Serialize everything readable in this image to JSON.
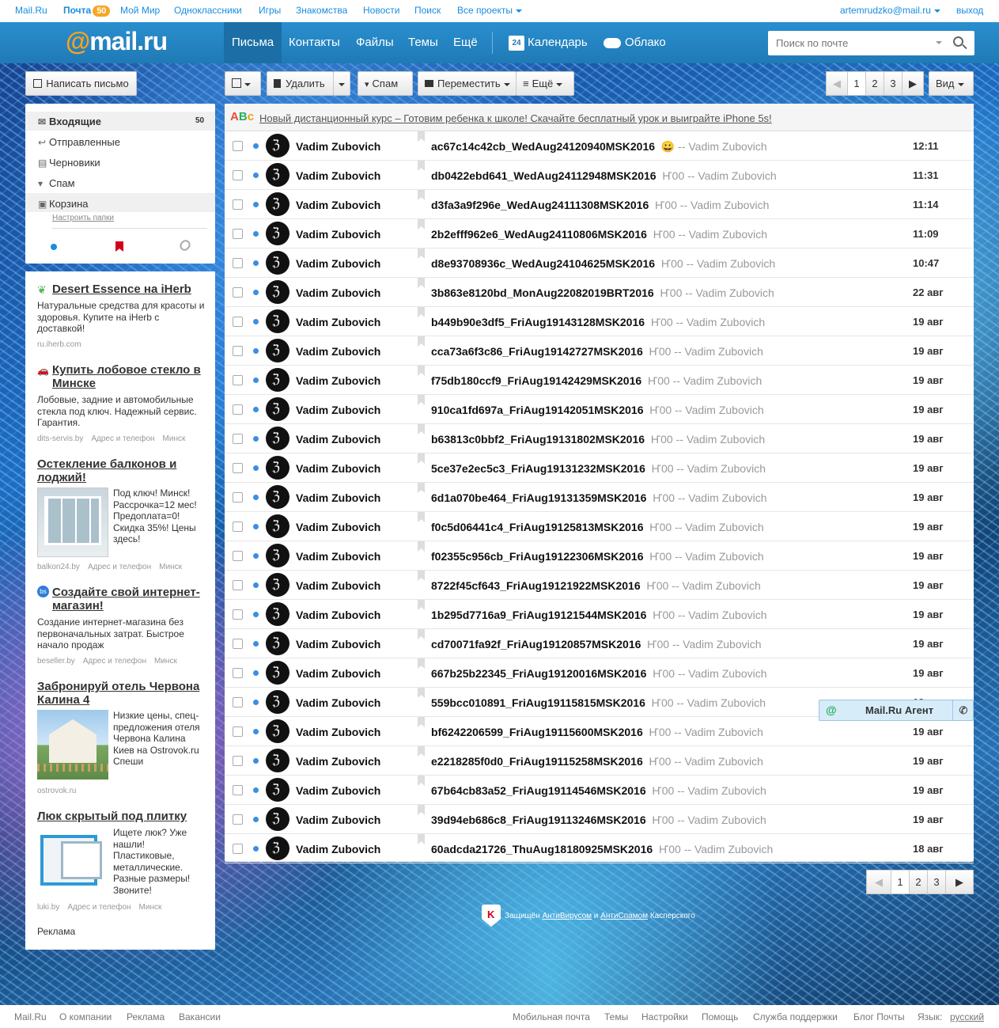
{
  "portal": {
    "links": [
      "Mail.Ru",
      "Почта",
      "Мой Мир",
      "Одноклассники",
      "Игры",
      "Знакомства",
      "Новости",
      "Поиск",
      "Все проекты"
    ],
    "mail_badge": "50",
    "user": "artemrudzko@mail.ru",
    "logout": "выход"
  },
  "header": {
    "logo_at": "@",
    "logo_text": "mail",
    "logo_tld": ".ru",
    "nav": [
      "Письма",
      "Контакты",
      "Файлы",
      "Темы",
      "Ещё"
    ],
    "calendar_day": "24",
    "calendar": "Календарь",
    "cloud": "Облако",
    "search_placeholder": "Поиск по почте"
  },
  "toolbar": {
    "compose": "Написать письмо",
    "delete": "Удалить",
    "spam": "Спам",
    "move": "Переместить",
    "more": "Ещё",
    "pages": [
      "1",
      "2",
      "3"
    ],
    "view": "Вид"
  },
  "folders": {
    "items": [
      {
        "label": "Входящие",
        "count": "50",
        "icon": "envelope-icon"
      },
      {
        "label": "Отправленные",
        "icon": "reply-icon"
      },
      {
        "label": "Черновики",
        "icon": "draft-icon"
      },
      {
        "label": "Спам",
        "icon": "thumb-down-icon"
      },
      {
        "label": "Корзина",
        "icon": "trash-icon"
      }
    ],
    "configure": "Настроить папки"
  },
  "ads": [
    {
      "title": "Desert Essence на iHerb",
      "text": "Натуральные средства для красоты и здоровья. Купите на iHerb с доставкой!",
      "source": "ru.iherb.com"
    },
    {
      "title": "Купить лобовое стекло в Минске",
      "text": "Лобовые, задние и автомобильные стекла под ключ. Надежный сервис. Гарантия.",
      "source": "dits-servis.by",
      "extra": [
        "Адрес и телефон",
        "Минск"
      ]
    },
    {
      "title": "Остекление балконов и лоджий!",
      "text": "Под ключ! Минск! Рассрочка=12 мес! Предоплата=0! Скидка 35%! Цены здесь!",
      "source": "balkon24.by",
      "extra": [
        "Адрес и телефон",
        "Минск"
      ]
    },
    {
      "title": "Создайте свой интернет-магазин!",
      "text": "Создание интернет-магазина без первоначальных затрат. Быстрое начало продаж",
      "source": "beseller.by",
      "extra": [
        "Адрес и телефон",
        "Минск"
      ]
    },
    {
      "title": "Забронируй отель Червона Калина 4",
      "text": "Низкие цены, спец-предложения отеля Червона Калина Киев на Ostrovok.ru Спеши",
      "source": "ostrovok.ru"
    },
    {
      "title": "Люк скрытый под плитку",
      "text": "Ищете люк? Уже нашли! Пластиковые, металлические. Разные размеры! Звоните!",
      "source": "luki.by",
      "extra": [
        "Адрес и телефон",
        "Минск"
      ]
    }
  ],
  "ads_label": "Реклама",
  "promo": "Новый дистанционный курс – Готовим ребенка к школе! Скачайте бесплатный урок и выиграйте iPhone 5s!",
  "messages": [
    {
      "from": "Vadim Zubovich",
      "subject": "ac67c14c42cb_WedAug24120940MSK2016",
      "snippet": "😀 -- Vadim Zubovich",
      "time": "12:11"
    },
    {
      "from": "Vadim Zubovich",
      "subject": "db0422ebd641_WedAug24112948MSK2016",
      "snippet": "Ҥ00 -- Vadim Zubovich",
      "time": "11:31"
    },
    {
      "from": "Vadim Zubovich",
      "subject": "d3fa3a9f296e_WedAug24111308MSK2016",
      "snippet": "Ҥ00 -- Vadim Zubovich",
      "time": "11:14"
    },
    {
      "from": "Vadim Zubovich",
      "subject": "2b2efff962e6_WedAug24110806MSK2016",
      "snippet": "Ҥ00 -- Vadim Zubovich",
      "time": "11:09"
    },
    {
      "from": "Vadim Zubovich",
      "subject": "d8e93708936c_WedAug24104625MSK2016",
      "snippet": "Ҥ00 -- Vadim Zubovich",
      "time": "10:47"
    },
    {
      "from": "Vadim Zubovich",
      "subject": "3b863e8120bd_MonAug22082019BRT2016",
      "snippet": "Ҥ00 -- Vadim Zubovich",
      "time": "22 авг"
    },
    {
      "from": "Vadim Zubovich",
      "subject": "b449b90e3df5_FriAug19143128MSK2016",
      "snippet": "Ҥ00 -- Vadim Zubovich",
      "time": "19 авг"
    },
    {
      "from": "Vadim Zubovich",
      "subject": "cca73a6f3c86_FriAug19142727MSK2016",
      "snippet": "Ҥ00 -- Vadim Zubovich",
      "time": "19 авг"
    },
    {
      "from": "Vadim Zubovich",
      "subject": "f75db180ccf9_FriAug19142429MSK2016",
      "snippet": "Ҥ00 -- Vadim Zubovich",
      "time": "19 авг"
    },
    {
      "from": "Vadim Zubovich",
      "subject": "910ca1fd697a_FriAug19142051MSK2016",
      "snippet": "Ҥ00 -- Vadim Zubovich",
      "time": "19 авг"
    },
    {
      "from": "Vadim Zubovich",
      "subject": "b63813c0bbf2_FriAug19131802MSK2016",
      "snippet": "Ҥ00 -- Vadim Zubovich",
      "time": "19 авг"
    },
    {
      "from": "Vadim Zubovich",
      "subject": "5ce37e2ec5c3_FriAug19131232MSK2016",
      "snippet": "Ҥ00 -- Vadim Zubovich",
      "time": "19 авг"
    },
    {
      "from": "Vadim Zubovich",
      "subject": "6d1a070be464_FriAug19131359MSK2016",
      "snippet": "Ҥ00 -- Vadim Zubovich",
      "time": "19 авг"
    },
    {
      "from": "Vadim Zubovich",
      "subject": "f0c5d06441c4_FriAug19125813MSK2016",
      "snippet": "Ҥ00 -- Vadim Zubovich",
      "time": "19 авг"
    },
    {
      "from": "Vadim Zubovich",
      "subject": "f02355c956cb_FriAug19122306MSK2016",
      "snippet": "Ҥ00 -- Vadim Zubovich",
      "time": "19 авг"
    },
    {
      "from": "Vadim Zubovich",
      "subject": "8722f45cf643_FriAug19121922MSK2016",
      "snippet": "Ҥ00 -- Vadim Zubovich",
      "time": "19 авг"
    },
    {
      "from": "Vadim Zubovich",
      "subject": "1b295d7716a9_FriAug19121544MSK2016",
      "snippet": "Ҥ00 -- Vadim Zubovich",
      "time": "19 авг"
    },
    {
      "from": "Vadim Zubovich",
      "subject": "cd70071fa92f_FriAug19120857MSK2016",
      "snippet": "Ҥ00 -- Vadim Zubovich",
      "time": "19 авг"
    },
    {
      "from": "Vadim Zubovich",
      "subject": "667b25b22345_FriAug19120016MSK2016",
      "snippet": "Ҥ00 -- Vadim Zubovich",
      "time": "19 авг"
    },
    {
      "from": "Vadim Zubovich",
      "subject": "559bcc010891_FriAug19115815MSK2016",
      "snippet": "Ҥ00 -- Vadim Zubovich",
      "time": "19 авг"
    },
    {
      "from": "Vadim Zubovich",
      "subject": "bf6242206599_FriAug19115600MSK2016",
      "snippet": "Ҥ00 -- Vadim Zubovich",
      "time": "19 авг"
    },
    {
      "from": "Vadim Zubovich",
      "subject": "e2218285f0d0_FriAug19115258MSK2016",
      "snippet": "Ҥ00 -- Vadim Zubovich",
      "time": "19 авг"
    },
    {
      "from": "Vadim Zubovich",
      "subject": "67b64cb83a52_FriAug19114546MSK2016",
      "snippet": "Ҥ00 -- Vadim Zubovich",
      "time": "19 авг"
    },
    {
      "from": "Vadim Zubovich",
      "subject": "39d94eb686c8_FriAug19113246MSK2016",
      "snippet": "Ҥ00 -- Vadim Zubovich",
      "time": "19 авг"
    },
    {
      "from": "Vadim Zubovich",
      "subject": "60adcda21726_ThuAug18180925MSK2016",
      "snippet": "Ҥ00 -- Vadim Zubovich",
      "time": "18 авг"
    }
  ],
  "agent": "Mail.Ru Агент",
  "protect": {
    "pre": "Защищён",
    "av": "АнтиВирусом",
    "and": "и",
    "as": "АнтиСпамом",
    "post": "Касперского"
  },
  "footer": {
    "left": [
      "Mail.Ru",
      "О компании",
      "Реклама",
      "Вакансии"
    ],
    "right": [
      "Мобильная почта",
      "Темы",
      "Настройки",
      "Помощь",
      "Служба поддержки",
      "Блог Почты"
    ],
    "lang_label": "Язык:",
    "lang": "русский"
  },
  "colors": {
    "header": "#2a8fcf",
    "accent": "#f9a11b",
    "link": "#168de2"
  }
}
